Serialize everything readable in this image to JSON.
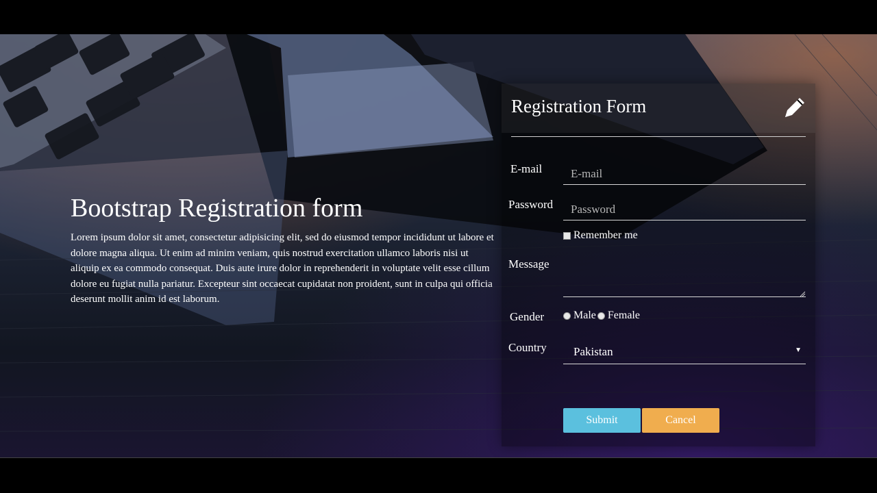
{
  "hero": {
    "title": "Bootstrap Registration form",
    "body": "Lorem ipsum dolor sit amet, consectetur adipisicing elit, sed do eiusmod tempor incididunt ut labore et dolore magna aliqua. Ut enim ad minim veniam, quis nostrud exercitation ullamco laboris nisi ut aliquip ex ea commodo consequat. Duis aute irure dolor in reprehenderit in voluptate velit esse cillum dolore eu fugiat nulla pariatur. Excepteur sint occaecat cupidatat non proident, sunt in culpa qui officia deserunt mollit anim id est laborum."
  },
  "form": {
    "title": "Registration Form",
    "icon": "pencil-icon",
    "email": {
      "label": "E-mail",
      "placeholder": "E-mail",
      "value": ""
    },
    "password": {
      "label": "Password",
      "placeholder": "Password",
      "value": ""
    },
    "remember": {
      "label": "Remember me",
      "checked": false
    },
    "message": {
      "label": "Message",
      "value": ""
    },
    "gender": {
      "label": "Gender",
      "options": [
        "Male",
        "Female"
      ],
      "selected": null
    },
    "country": {
      "label": "Country",
      "selected": "Pakistan"
    },
    "submit_label": "Submit",
    "cancel_label": "Cancel"
  },
  "colors": {
    "submit": "#5bc0de",
    "cancel": "#f0ad4e",
    "text": "#ffffff"
  }
}
